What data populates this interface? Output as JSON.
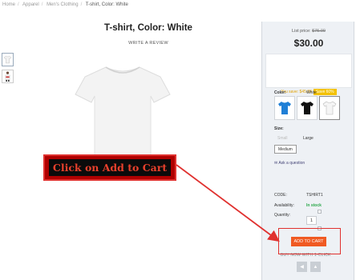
{
  "breadcrumb": [
    "Home",
    "Apparel",
    "Men's Clothing",
    "T-shirt, Color: White"
  ],
  "product": {
    "title": "T-shirt, Color: White",
    "write_review": "WRITE A REVIEW"
  },
  "pricing": {
    "list_price_label": "List price:",
    "list_price": "$75.00",
    "price": "$30.00",
    "savings_text": "You save: $45.00",
    "save_badge": "Save 60%"
  },
  "options": {
    "color_label": "Color:",
    "color_value": "White",
    "colors": [
      "blue",
      "black",
      "white"
    ],
    "size_label": "Size:",
    "sizes": [
      {
        "label": "Small",
        "state": "disabled"
      },
      {
        "label": "Large",
        "state": "normal"
      },
      {
        "label": "Medium",
        "state": "selected"
      }
    ]
  },
  "ask_question": "Ask a question",
  "specs": {
    "code_label": "CODE:",
    "code": "TSHIRT1",
    "availability_label": "Availability:",
    "availability": "In stock",
    "quantity_label": "Quantity:",
    "quantity": "1"
  },
  "actions": {
    "add_to_cart": "ADD TO CART",
    "buy_now": "BUY NOW WITH 1-CLICK"
  },
  "annotation": {
    "callout_text": "Click on Add to Cart"
  },
  "colors": {
    "accent": "#f05a22",
    "annotation_red": "#e0312f",
    "in_stock": "#2aa84a",
    "panel_bg": "#eef1f5"
  }
}
